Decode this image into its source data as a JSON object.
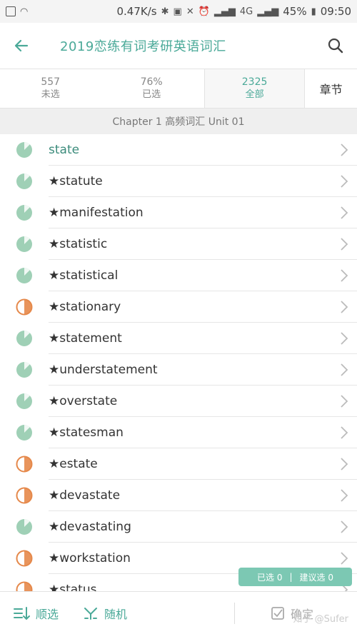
{
  "status_bar": {
    "speed": "0.47K/s",
    "network": "4G",
    "battery": "45%",
    "time": "09:50"
  },
  "app_bar": {
    "title": "2019恋练有词考研英语词汇"
  },
  "tabs": [
    {
      "count": "557",
      "label": "未选"
    },
    {
      "count": "76%",
      "label": "已选"
    },
    {
      "count": "2325",
      "label": "全部"
    }
  ],
  "chapter_tab_label": "章节",
  "chapter_header": "Chapter 1 高频词汇 Unit 01",
  "words": [
    {
      "text": "state",
      "status": "green"
    },
    {
      "text": "★statute",
      "status": "green"
    },
    {
      "text": "★manifestation",
      "status": "green"
    },
    {
      "text": "★statistic",
      "status": "green"
    },
    {
      "text": "★statistical",
      "status": "green"
    },
    {
      "text": "★stationary",
      "status": "orange"
    },
    {
      "text": "★statement",
      "status": "green"
    },
    {
      "text": "★understatement",
      "status": "green"
    },
    {
      "text": "★overstate",
      "status": "green"
    },
    {
      "text": "★statesman",
      "status": "green"
    },
    {
      "text": "★estate",
      "status": "orange"
    },
    {
      "text": "★devastate",
      "status": "orange"
    },
    {
      "text": "★devastating",
      "status": "green"
    },
    {
      "text": "★workstation",
      "status": "orange"
    },
    {
      "text": "★status",
      "status": "orange"
    }
  ],
  "selection_badge": {
    "selected": "已选 0",
    "separator": "|",
    "suggested": "建议选 0"
  },
  "bottom_bar": {
    "order_label": "顺选",
    "random_label": "随机",
    "confirm_label": "确定"
  },
  "watermark": "知乎 @Sufer",
  "colors": {
    "accent": "#4aa998",
    "green": "#9fd0b6",
    "orange": "#e5884a"
  }
}
